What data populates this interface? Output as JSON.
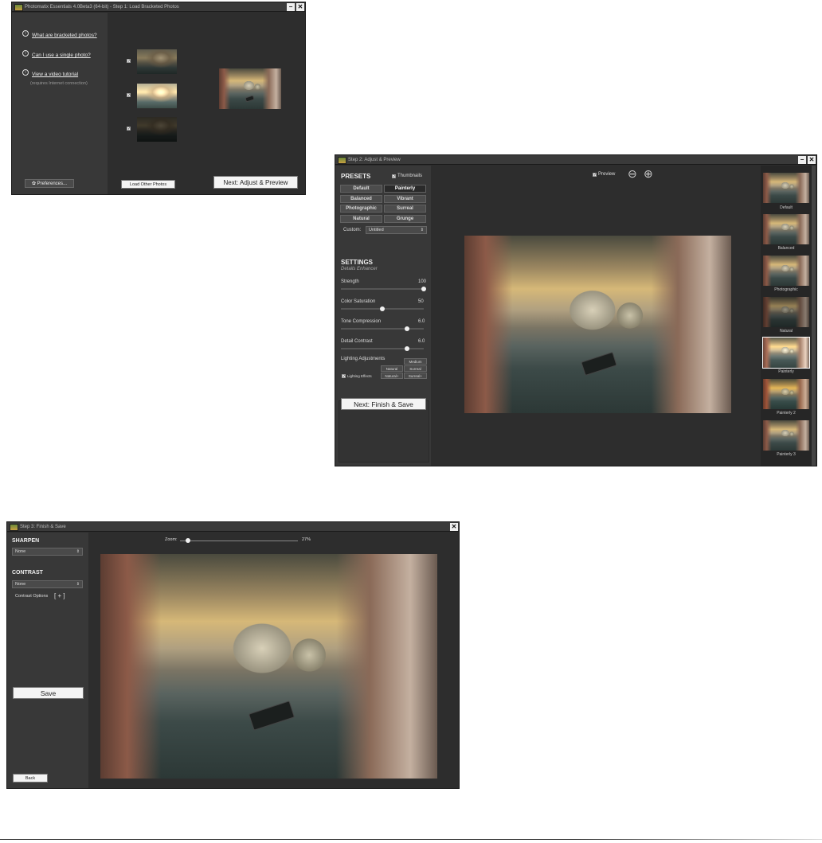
{
  "win1": {
    "title": "Photomatix Essentials  4.0Beta3 (64-bit) - Step 1: Load Bracketed Photos",
    "links": [
      {
        "label": "What are bracketed photos?"
      },
      {
        "label": "Can I use a single photo?"
      },
      {
        "label": "View a video tutorial",
        "sub": "(requires Internet connection)"
      }
    ],
    "preferences_label": "Preferences...",
    "load_other_label": "Load Other Photos",
    "next_label": "Next: Adjust & Preview"
  },
  "win2": {
    "title": "Step 2: Adjust & Preview",
    "presets_heading": "PRESETS",
    "thumbnails_label": "Thumbnails",
    "presets": [
      "Default",
      "Painterly",
      "Balanced",
      "Vibrant",
      "Photographic",
      "Surreal",
      "Natural",
      "Grunge"
    ],
    "active_preset": "Painterly",
    "custom_label": "Custom:",
    "custom_value": "Untitled",
    "settings_heading": "SETTINGS",
    "settings_sub": "Details Enhancer",
    "sliders": [
      {
        "label": "Strength",
        "value": "100",
        "level": 1.0
      },
      {
        "label": "Color Saturation",
        "value": "50",
        "level": 0.5
      },
      {
        "label": "Tone Compression",
        "value": "6.0",
        "level": 0.8
      },
      {
        "label": "Detail Contrast",
        "value": "6.0",
        "level": 0.8
      }
    ],
    "lighting_label": "Lighting Adjustments",
    "lighting_medium": "Medium",
    "lighting_effects_label": "Lighting Effects",
    "lighting_buttons": [
      "Natural",
      "Surreal",
      "Natural+",
      "Surreal+"
    ],
    "next_label": "Next: Finish & Save",
    "preview_label": "Preview",
    "thumbnails": [
      "Default",
      "Balanced",
      "Photographic",
      "Natural",
      "Painterly",
      "Painterly 2",
      "Painterly 3"
    ]
  },
  "win3": {
    "title": "Step 3: Finish & Save",
    "sharpen_heading": "SHARPEN",
    "sharpen_value": "None",
    "contrast_heading": "CONTRAST",
    "contrast_value": "None",
    "contrast_options_label": "Contrast Options",
    "contrast_options_toggle": "[ + ]",
    "save_label": "Save",
    "back_label": "Back",
    "zoom_label": "Zoom:",
    "zoom_value": "27%",
    "zoom_level": 0.07
  },
  "icons": {
    "minimize": "−",
    "close": "✕",
    "info": "i",
    "gear": "✿",
    "zoom_out": "⊖",
    "zoom_in": "⊕",
    "check": "✓",
    "updown": "⇕"
  }
}
